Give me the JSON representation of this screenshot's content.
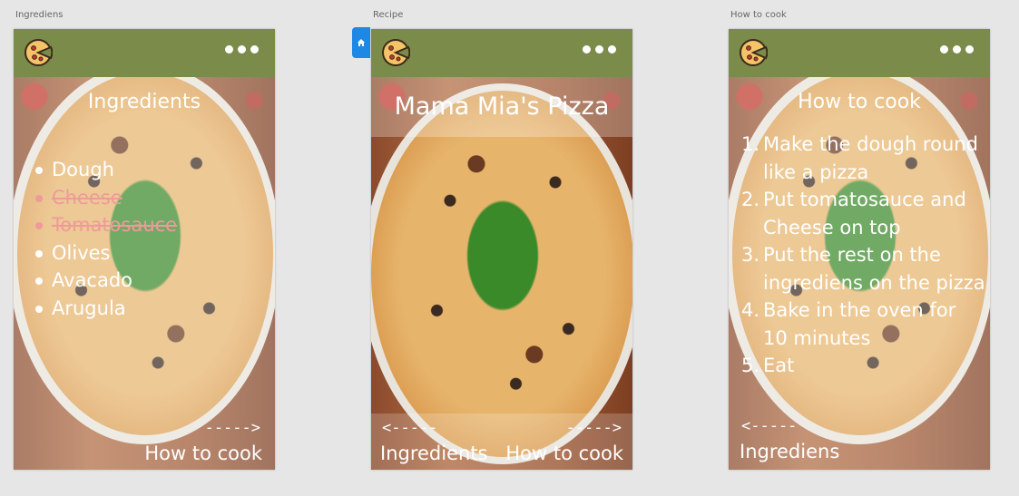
{
  "artboards": {
    "ingredients": {
      "label": "Ingrediens",
      "title": "Ingredients",
      "items": [
        {
          "text": "Dough",
          "checked": false
        },
        {
          "text": "Cheese",
          "checked": true
        },
        {
          "text": "Tomatosauce",
          "checked": true
        },
        {
          "text": "Olives",
          "checked": false
        },
        {
          "text": "Avacado",
          "checked": false
        },
        {
          "text": "Arugula",
          "checked": false
        }
      ],
      "next_arrow": "----->",
      "next_label": "How to cook"
    },
    "recipe": {
      "label": "Recipe",
      "title": "Mama Mia's Pizza",
      "prev_arrow": "<-----",
      "prev_label": "Ingredients",
      "next_arrow": "----->",
      "next_label": "How to cook"
    },
    "how_to_cook": {
      "label": "How to cook",
      "title": "How to cook",
      "steps": [
        {
          "num": "1.",
          "lines": [
            "Make the dough round",
            "like a pizza"
          ]
        },
        {
          "num": "2.",
          "lines": [
            "Put tomatosauce and",
            "Cheese on top"
          ]
        },
        {
          "num": "3.",
          "lines": [
            "Put the rest on the",
            "ingrediens on the pizza"
          ]
        },
        {
          "num": "4.",
          "lines": [
            "Bake in the oven for",
            "10 minutes"
          ]
        },
        {
          "num": "5.",
          "lines": [
            "Eat"
          ]
        }
      ],
      "prev_arrow": "<-----",
      "prev_label": "Ingrediens"
    }
  },
  "icons": {
    "logo": "pizza-logo-icon",
    "menu": "more-dots-icon",
    "home": "home-icon"
  },
  "colors": {
    "topbar": "#7a8b4a",
    "checked_item": "#ef9a9a",
    "home_tab": "#1e88e5"
  }
}
